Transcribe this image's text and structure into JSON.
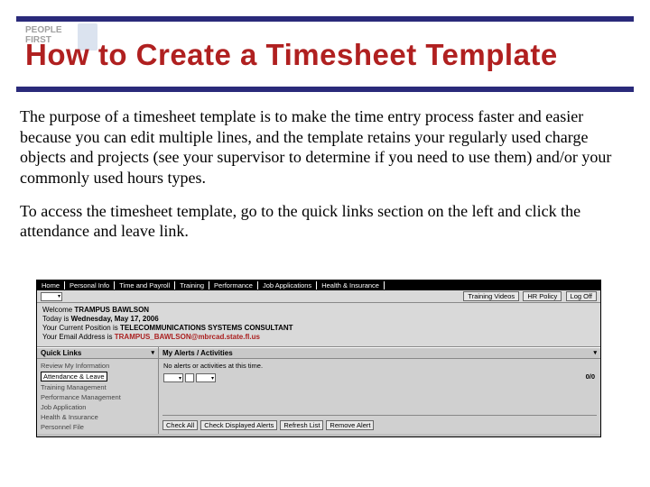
{
  "logo": {
    "line1": "PEOPLE",
    "line2": "FIRST"
  },
  "title": "How to Create a Timesheet Template",
  "para1": "The purpose of a timesheet template is to make the time entry process faster and easier because you can edit multiple lines, and the template retains your regularly used charge objects and projects (see your supervisor to determine if you need to use them) and/or your commonly used hours types.",
  "para2": "To access the timesheet template, go to the quick links section on the left and click the attendance and leave link.",
  "screenshot": {
    "nav": [
      "Home",
      "Personal Info",
      "Time and Payroll",
      "Training",
      "Performance",
      "Job Applications",
      "Health & Insurance"
    ],
    "toolbar_links": [
      "Training Videos",
      "HR Policy",
      "Log Off"
    ],
    "welcome": {
      "l1_a": "Welcome ",
      "l1_b": "TRAMPUS BAWLSON",
      "l2_a": "Today is ",
      "l2_b": "Wednesday, May 17, 2006",
      "l3_a": "Your Current Position is ",
      "l3_b": "TELECOMMUNICATIONS SYSTEMS CONSULTANT",
      "l4_a": "Your Email Address is ",
      "l4_b": "TRAMPUS_BAWLSON@mbrcad.state.fl.us"
    },
    "quick_links": {
      "header": "Quick Links",
      "items": [
        "Review My Information",
        "Attendance & Leave",
        "Training Management",
        "Performance Management",
        "Job Application",
        "Health & Insurance",
        "Personnel File"
      ],
      "highlight_index": 1
    },
    "alerts": {
      "header": "My Alerts / Activities",
      "none_msg": "No alerts or activities at this time.",
      "count": "0/0",
      "buttons": [
        "Check All",
        "Check Displayed Alerts",
        "Refresh List",
        "Remove Alert"
      ]
    }
  }
}
